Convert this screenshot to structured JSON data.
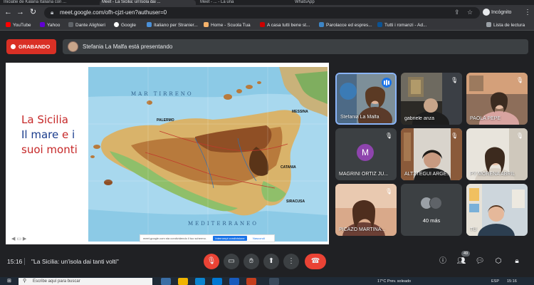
{
  "browser": {
    "tabs": [
      {
        "label": "Iniciatie de Kalaria Italiana con ..."
      },
      {
        "label": "Meet - La Sicilia: un'isola dai ...",
        "active": true
      },
      {
        "label": "Meet - ... - La una"
      },
      {
        "label": "WhatsApp"
      }
    ],
    "url": "meet.google.com/ofh-cjzt-uen?authuser=0",
    "profile_label": "Incógnito",
    "bookmarks": [
      {
        "label": "YouTube",
        "color": "#ff0000"
      },
      {
        "label": "Yahoo",
        "color": "#6001d2"
      },
      {
        "label": "Dante Alighieri",
        "color": "#3c4043"
      },
      {
        "label": "Google",
        "color": "#ffffff"
      },
      {
        "label": "Italiano per Stranier...",
        "color": "#4a90d9"
      },
      {
        "label": "Home - Scuola Tua",
        "color": "#f6b26b"
      },
      {
        "label": "A casa tutti bene st...",
        "color": "#cc0000"
      },
      {
        "label": "Parolacce ed espres...",
        "color": "#3d85c6"
      },
      {
        "label": "Tutti i romanzi - Ad...",
        "color": "#0b5394"
      }
    ],
    "reading_list": "Lista de lectura"
  },
  "meet": {
    "recording_label": "GRABANDO",
    "presenter_text": "Stefania La Malfa está presentando",
    "slide": {
      "title_line1": "La Sicilia",
      "title_line2a": "Il mare",
      "title_line2b": "e",
      "title_line2c": "i",
      "title_line3": "suoi monti",
      "sea_north": "MAR  TIRRENO",
      "sea_south": "MEDITERRANEO",
      "map_label_palermo": "PALERMO",
      "map_label_messina": "MESSINA",
      "map_label_catania": "CATANIA",
      "map_label_siracusa": "SIRACUSA",
      "share_text": "meet.google.com sta condividendo il tuo schermo.",
      "share_stop": "Interrompi condivisione",
      "share_hide": "Nascondi"
    },
    "participants": [
      {
        "name": "Stefania La Malfa",
        "speaking": true
      },
      {
        "name": "gabriele anza",
        "muted": true
      },
      {
        "name": "PAOLA PEPE",
        "muted": true
      },
      {
        "name": "MAGRINI ORTIZ JU...",
        "avatar_letter": "M",
        "muted": true
      },
      {
        "name": "ALTZTEGUI ARGE...",
        "muted": true
      },
      {
        "name": "PY MORENA ABRIL",
        "muted": true
      },
      {
        "name": "PICAZO MARTINA...",
        "muted": true
      },
      {
        "name": "",
        "more_count": "40 más"
      },
      {
        "name": "TÚ"
      }
    ],
    "bottom": {
      "time": "15:16",
      "meeting_title": "\"La Sicilia: un'isola dai tanti volti\"",
      "people_count": "49"
    }
  },
  "taskbar": {
    "search_placeholder": "Escribe aquí para buscar",
    "weather": "17°C  Prev. soleado",
    "language": "ESP",
    "clock": "15:16"
  }
}
